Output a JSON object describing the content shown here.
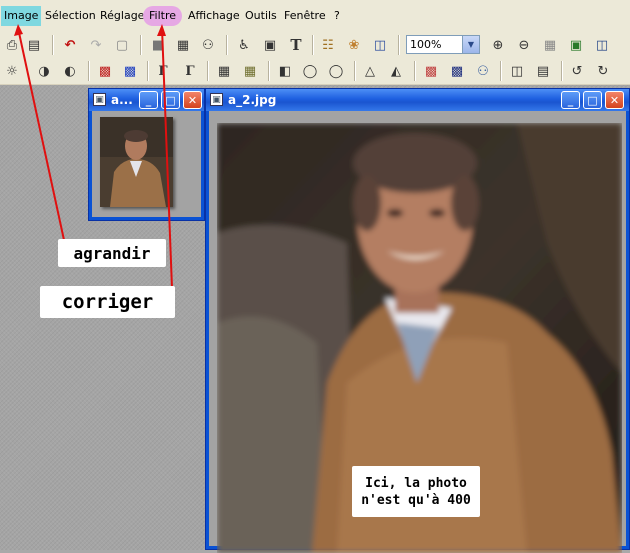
{
  "menubar": {
    "items": [
      {
        "label": "Image",
        "state": "highlighted"
      },
      {
        "label": "Sélection"
      },
      {
        "label": "Réglage"
      },
      {
        "label": "Filtre",
        "state": "circled"
      },
      {
        "label": "Affichage"
      },
      {
        "label": "Outils"
      },
      {
        "label": "Fenêtre"
      },
      {
        "label": "?"
      }
    ]
  },
  "toolbar": {
    "zoom_value": "100%"
  },
  "thumbnail_window": {
    "title": "a..."
  },
  "main_window": {
    "title": "a_2.jpg"
  },
  "annotations": {
    "agrandir": "agrandir",
    "corriger": "corriger",
    "note_line1": "Ici, la photo",
    "note_line2": "n'est qu'à 400"
  },
  "colors": {
    "arrow": "#e01010",
    "menu_highlight": "#7fd8e0",
    "filtre_circle": "#e6a8e4",
    "titlebar": "#1e5fe0"
  }
}
